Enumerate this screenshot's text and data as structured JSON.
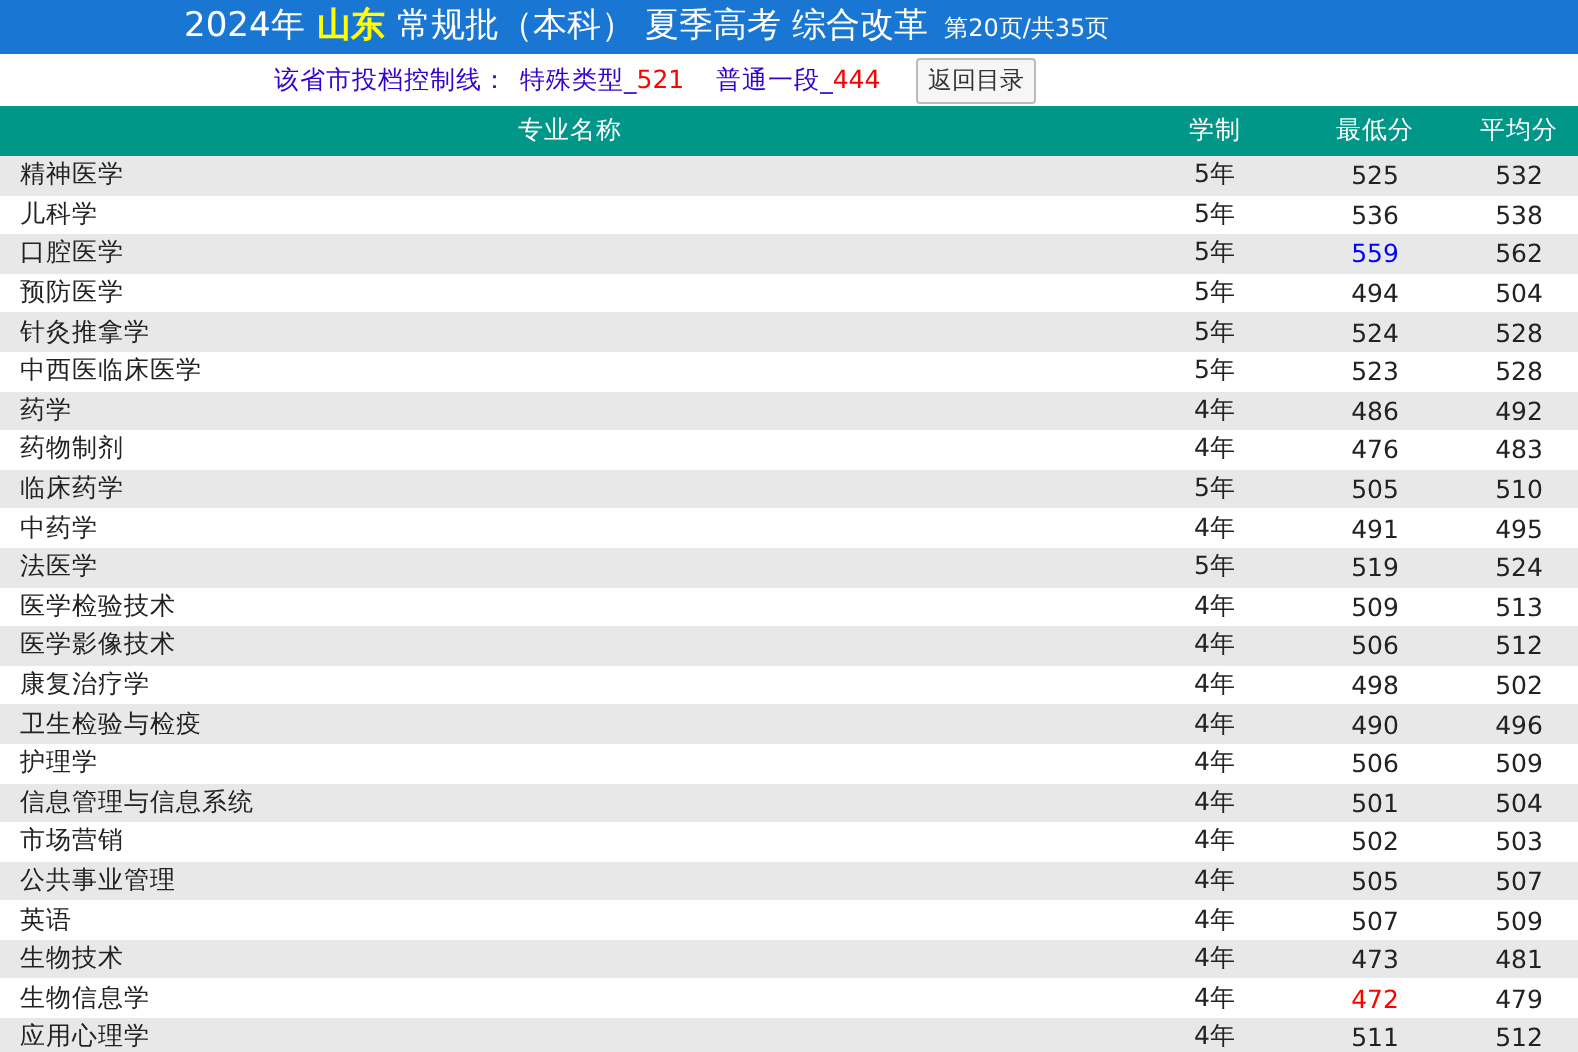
{
  "header": {
    "year": "2024年",
    "province": "山东",
    "title": "常规批（本科） 夏季高考 综合改革",
    "page_info": "第20页/共35页"
  },
  "control_line": {
    "label": "该省市投档控制线：",
    "items": [
      {
        "name": "特殊类型_",
        "value": "521"
      },
      {
        "name": "普通一段_",
        "value": "444"
      }
    ],
    "button": "返回目录"
  },
  "table": {
    "columns": [
      "专业名称",
      "学制",
      "最低分",
      "平均分"
    ],
    "rows": [
      {
        "major": "精神医学",
        "years": "5年",
        "min": "525",
        "avg": "532"
      },
      {
        "major": "儿科学",
        "years": "5年",
        "min": "536",
        "avg": "538"
      },
      {
        "major": "口腔医学",
        "years": "5年",
        "min": "559",
        "avg": "562",
        "color": "#0000ff"
      },
      {
        "major": "预防医学",
        "years": "5年",
        "min": "494",
        "avg": "504"
      },
      {
        "major": "针灸推拿学",
        "years": "5年",
        "min": "524",
        "avg": "528"
      },
      {
        "major": "中西医临床医学",
        "years": "5年",
        "min": "523",
        "avg": "528"
      },
      {
        "major": "药学",
        "years": "4年",
        "min": "486",
        "avg": "492"
      },
      {
        "major": "药物制剂",
        "years": "4年",
        "min": "476",
        "avg": "483"
      },
      {
        "major": "临床药学",
        "years": "5年",
        "min": "505",
        "avg": "510"
      },
      {
        "major": "中药学",
        "years": "4年",
        "min": "491",
        "avg": "495"
      },
      {
        "major": "法医学",
        "years": "5年",
        "min": "519",
        "avg": "524"
      },
      {
        "major": "医学检验技术",
        "years": "4年",
        "min": "509",
        "avg": "513"
      },
      {
        "major": "医学影像技术",
        "years": "4年",
        "min": "506",
        "avg": "512"
      },
      {
        "major": "康复治疗学",
        "years": "4年",
        "min": "498",
        "avg": "502"
      },
      {
        "major": "卫生检验与检疫",
        "years": "4年",
        "min": "490",
        "avg": "496"
      },
      {
        "major": "护理学",
        "years": "4年",
        "min": "506",
        "avg": "509"
      },
      {
        "major": "信息管理与信息系统",
        "years": "4年",
        "min": "501",
        "avg": "504"
      },
      {
        "major": "市场营销",
        "years": "4年",
        "min": "502",
        "avg": "503"
      },
      {
        "major": "公共事业管理",
        "years": "4年",
        "min": "505",
        "avg": "507"
      },
      {
        "major": "英语",
        "years": "4年",
        "min": "507",
        "avg": "509"
      },
      {
        "major": "生物技术",
        "years": "4年",
        "min": "473",
        "avg": "481"
      },
      {
        "major": "生物信息学",
        "years": "4年",
        "min": "472",
        "avg": "479",
        "color": "#ff0000"
      },
      {
        "major": "应用心理学",
        "years": "4年",
        "min": "511",
        "avg": "512"
      }
    ]
  }
}
